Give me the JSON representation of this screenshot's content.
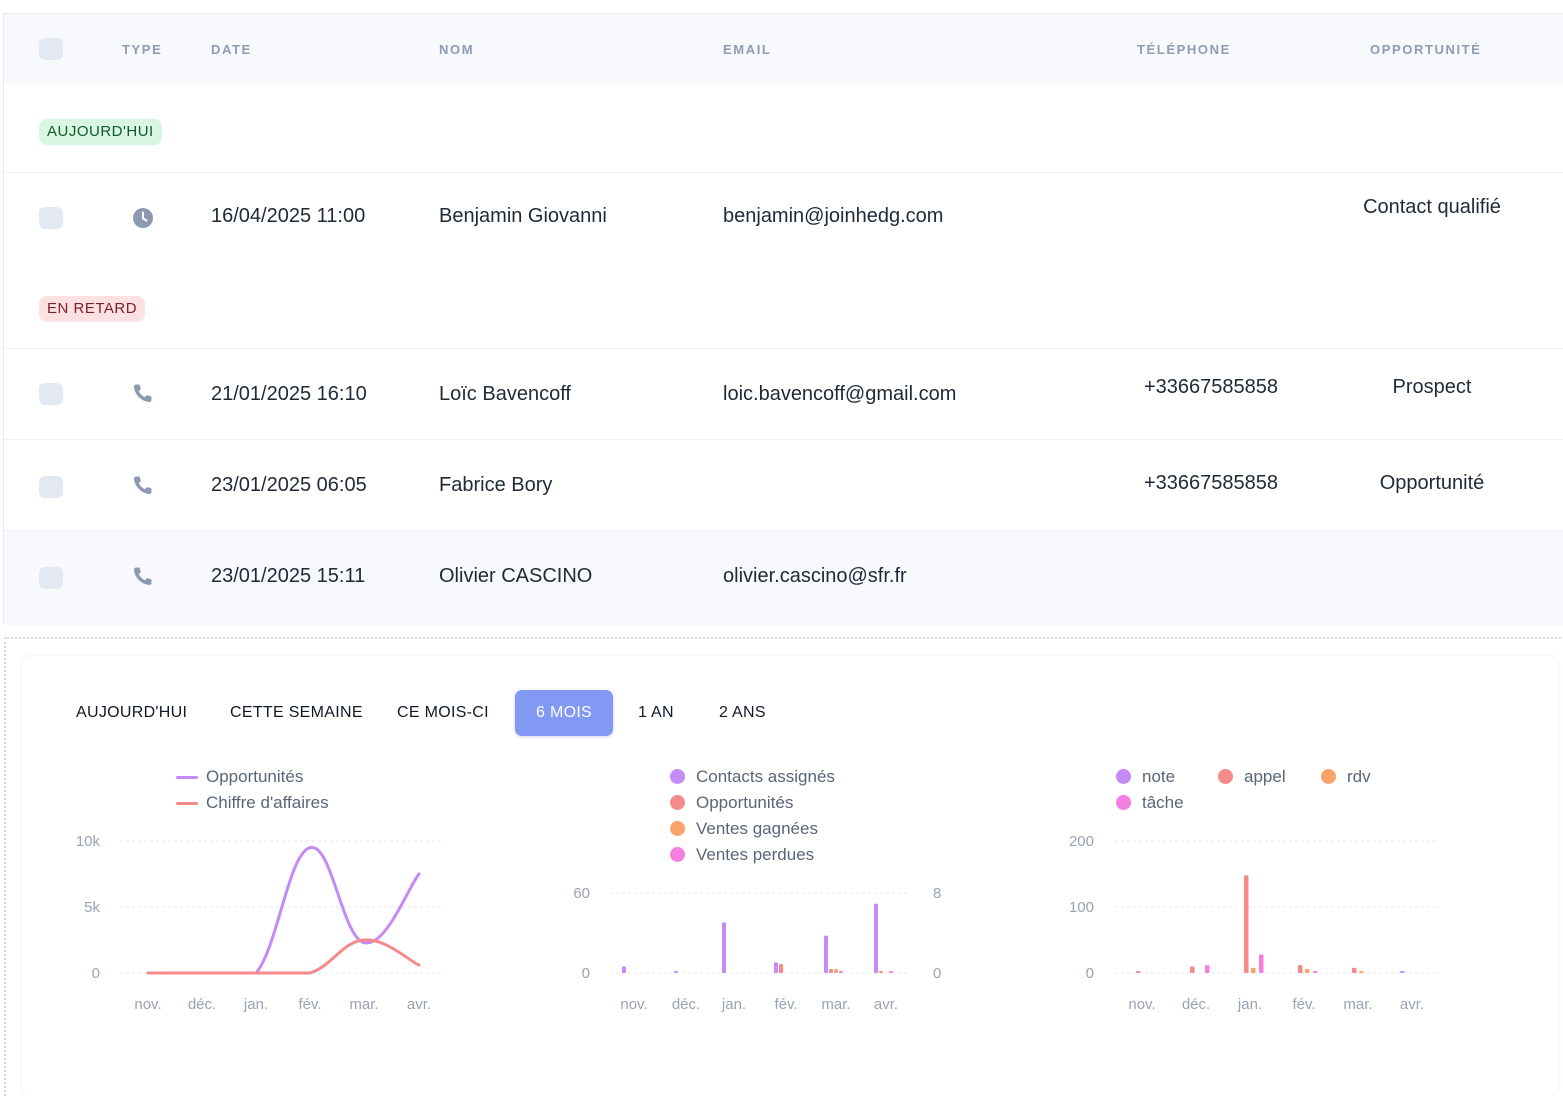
{
  "table": {
    "headers": {
      "type": "TYPE",
      "date": "DATE",
      "nom": "NOM",
      "email": "EMAIL",
      "telephone": "TÉLÉPHONE",
      "opportunite": "OPPORTUNITÉ"
    },
    "sections": [
      {
        "badge": "AUJOURD'HUI",
        "rows": [
          {
            "type_icon": "clock-icon",
            "date": "16/04/2025 11:00",
            "nom": "Benjamin Giovanni",
            "email": "benjamin@joinhedg.com",
            "telephone": "",
            "opportunite": "Contact qualifié"
          }
        ]
      },
      {
        "badge": "EN RETARD",
        "rows": [
          {
            "type_icon": "phone-icon",
            "date": "21/01/2025 16:10",
            "nom": "Loïc Bavencoff",
            "email": "loic.bavencoff@gmail.com",
            "telephone": "+33667585858",
            "opportunite": "Prospect"
          },
          {
            "type_icon": "phone-icon",
            "date": "23/01/2025 06:05",
            "nom": "Fabrice Bory",
            "email": "",
            "telephone": "+33667585858",
            "opportunite": "Opportunité"
          },
          {
            "type_icon": "phone-icon",
            "date": "23/01/2025 15:11",
            "nom": "Olivier CASCINO",
            "email": "olivier.cascino@sfr.fr",
            "telephone": "",
            "opportunite": ""
          }
        ]
      }
    ]
  },
  "tabs": [
    {
      "label": "AUJOURD'HUI",
      "active": false
    },
    {
      "label": "CETTE SEMAINE",
      "active": false
    },
    {
      "label": "CE MOIS-CI",
      "active": false
    },
    {
      "label": "6 MOIS",
      "active": true
    },
    {
      "label": "1 AN",
      "active": false
    },
    {
      "label": "2 ANS",
      "active": false
    }
  ],
  "colors": {
    "purple": "#c58af5",
    "salmon": "#f48a8a",
    "orange": "#f9a46b",
    "pink": "#f57fe0",
    "accent": "#8199f3",
    "grid": "#e4e7ec",
    "axis_text": "#9aa3b2"
  },
  "chart_data": [
    {
      "type": "line",
      "categories": [
        "nov.",
        "déc.",
        "jan.",
        "fév.",
        "mar.",
        "avr."
      ],
      "series": [
        {
          "name": "Opportunités",
          "color": "#c58af5",
          "values": [
            0,
            0,
            0,
            9500,
            2300,
            7500
          ]
        },
        {
          "name": "Chiffre d'affaires",
          "color": "#f48a8a",
          "values": [
            0,
            0,
            0,
            0,
            2500,
            600
          ]
        }
      ],
      "yticks": [
        "10k",
        "5k",
        "0"
      ],
      "ylim": [
        0,
        10000
      ],
      "legend": "top-left"
    },
    {
      "type": "bar",
      "categories": [
        "nov.",
        "déc.",
        "jan.",
        "fév.",
        "mar.",
        "avr."
      ],
      "series": [
        {
          "name": "Contacts assignés",
          "color": "#c58af5",
          "values": [
            5,
            1,
            38,
            8,
            28,
            52
          ]
        },
        {
          "name": "Opportunités",
          "color": "#f48a8a",
          "values": [
            0,
            0,
            0,
            0.9,
            0.4,
            0.2
          ]
        },
        {
          "name": "Ventes gagnées",
          "color": "#f9a46b",
          "values": [
            0,
            0,
            0,
            0,
            0.4,
            0
          ]
        },
        {
          "name": "Ventes perdues",
          "color": "#f57fe0",
          "values": [
            0,
            0,
            0,
            0,
            0.2,
            0.2
          ]
        }
      ],
      "yticks_left": [
        "60",
        "0"
      ],
      "yticks_right": [
        "8",
        "0"
      ],
      "ylim_left": [
        0,
        60
      ],
      "ylim_right": [
        0,
        8
      ],
      "legend": "top-left"
    },
    {
      "type": "bar",
      "categories": [
        "nov.",
        "déc.",
        "jan.",
        "fév.",
        "mar.",
        "avr."
      ],
      "series": [
        {
          "name": "note",
          "color": "#c58af5",
          "values": [
            0,
            0,
            0,
            0,
            0,
            1
          ]
        },
        {
          "name": "appel",
          "color": "#f48a8a",
          "values": [
            2,
            10,
            148,
            12,
            8,
            0
          ]
        },
        {
          "name": "rdv",
          "color": "#f9a46b",
          "values": [
            0,
            0,
            8,
            6,
            1,
            0
          ]
        },
        {
          "name": "tâche",
          "color": "#f57fe0",
          "values": [
            0,
            12,
            28,
            2,
            0,
            0
          ]
        }
      ],
      "yticks": [
        "200",
        "100",
        "0"
      ],
      "ylim": [
        0,
        200
      ],
      "legend": "top-left"
    }
  ]
}
